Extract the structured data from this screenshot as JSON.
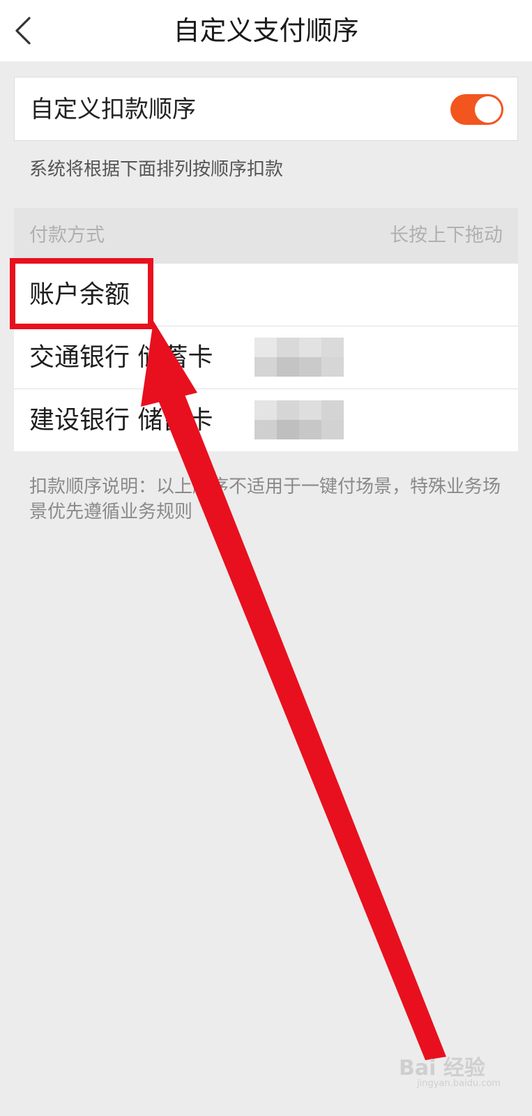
{
  "header": {
    "title": "自定义支付顺序",
    "back_icon": "chevron-left-icon"
  },
  "toggle_card": {
    "label": "自定义扣款顺序",
    "enabled": true,
    "accent_color": "#f2561e"
  },
  "hint": "系统将根据下面排列按顺序扣款",
  "list_header": {
    "left": "付款方式",
    "right": "长按上下拖动"
  },
  "payment_methods": [
    {
      "label": "账户余额"
    },
    {
      "label": "交通银行 储蓄卡"
    },
    {
      "label": "建设银行 储蓄卡"
    }
  ],
  "note": "扣款顺序说明：以上顺序不适用于一键付场景，特殊业务场景优先遵循业务规则",
  "annotation": {
    "color": "#e8101e"
  },
  "watermark": {
    "main": "Bai 经验",
    "sub": "jingyan.baidu.com"
  }
}
